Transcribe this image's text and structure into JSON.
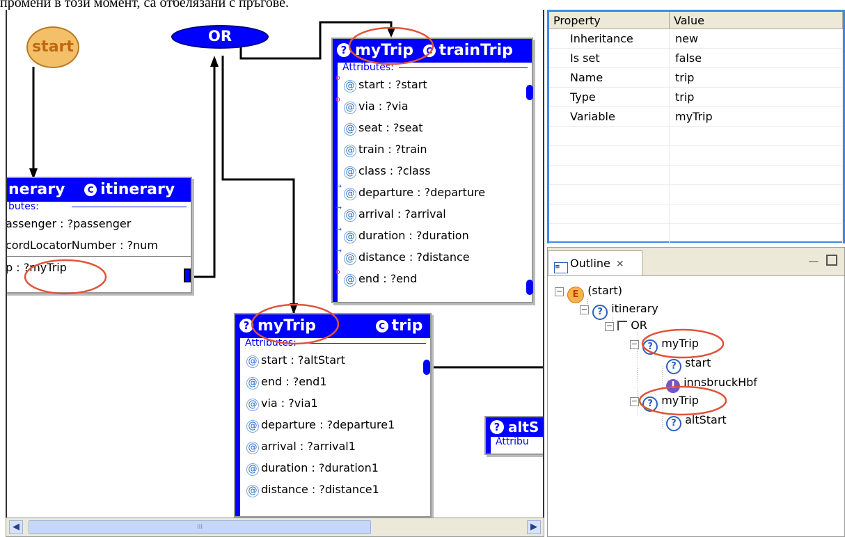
{
  "caption": "промени в този момент, са отбелязани с пръгове.",
  "diagram": {
    "start_label": "start",
    "or_label": "OR",
    "train_node": {
      "title": "myTrip",
      "type": "trainTrip",
      "attributes_label": "Attributes:",
      "attributes": [
        "start : ?start",
        "via : ?via",
        "seat : ?seat",
        "train : ?train",
        "class : ?class",
        "departure : ?departure",
        "arrival : ?arrival",
        "duration : ?duration",
        "distance : ?distance",
        "end : ?end"
      ]
    },
    "itinerary_node": {
      "title": "nerary",
      "type": "itinerary",
      "attributes_label": "butes:",
      "attributes": [
        "assenger : ?passenger",
        "cordLocatorNumber : ?num",
        "p : ?myTrip"
      ]
    },
    "trip_node": {
      "title": "myTrip",
      "type": "trip",
      "attributes_label": "Attributes:",
      "attributes": [
        "start : ?altStart",
        "end : ?end1",
        "via : ?via1",
        "departure : ?departure1",
        "arrival : ?arrival1",
        "duration : ?duration1",
        "distance : ?distance1"
      ]
    },
    "alt_node": {
      "title": "altS",
      "attributes_label": "Attribu"
    },
    "scroll_grip": "III"
  },
  "properties": {
    "headers": [
      "Property",
      "Value"
    ],
    "rows": [
      [
        "Inheritance",
        "new"
      ],
      [
        "Is set",
        "false"
      ],
      [
        "Name",
        "trip"
      ],
      [
        "Type",
        "trip"
      ],
      [
        "Variable",
        "myTrip"
      ]
    ]
  },
  "outline": {
    "tab_label": "Outline",
    "tree": [
      {
        "label": "(start)",
        "icon": "event-icon"
      },
      {
        "label": "itinerary",
        "icon": "question-icon"
      },
      {
        "label": "OR",
        "icon": "or-icon"
      },
      {
        "label": "myTrip",
        "icon": "question-icon"
      },
      {
        "label": "start",
        "icon": "question-icon"
      },
      {
        "label": "innsbruckHbf",
        "icon": "instance-icon"
      },
      {
        "label": "myTrip",
        "icon": "question-icon"
      },
      {
        "label": "altStart",
        "icon": "question-icon"
      }
    ]
  },
  "colors": {
    "node_header": "#0000ff",
    "highlight_ellipse": "#e0543a",
    "start_fill": "#f3c069",
    "selection_border": "#3d8be6"
  }
}
